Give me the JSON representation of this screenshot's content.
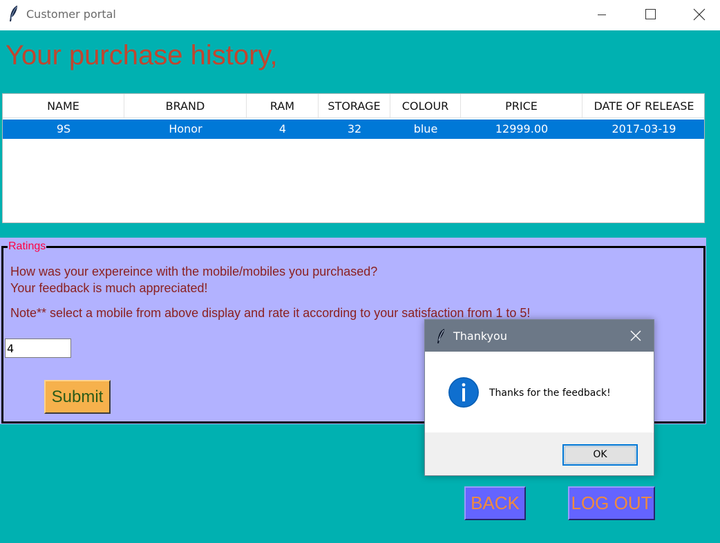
{
  "window": {
    "title": "Customer portal",
    "icon": "feather-icon"
  },
  "heading": "Your purchase history,",
  "table": {
    "columns": [
      "NAME",
      "BRAND",
      "RAM",
      "STORAGE",
      "COLOUR",
      "PRICE",
      "DATE OF RELEASE"
    ],
    "rows": [
      [
        "9S",
        "Honor",
        "4",
        "32",
        "blue",
        "12999.00",
        "2017-03-19"
      ]
    ],
    "selected_row": 0
  },
  "ratings": {
    "legend": "Ratings",
    "question_line1": "How was your expereince with the mobile/mobiles you purchased?",
    "question_line2": "Your feedback is much appreciated!",
    "note": "Note** select a mobile from above display and rate it according to your satisfaction from 1 to 5!",
    "rating_value": "4",
    "submit_label": "Submit"
  },
  "buttons": {
    "back_label": "BACK",
    "logout_label": "LOG OUT"
  },
  "dialog": {
    "title": "Thankyou",
    "message": "Thanks for the feedback!",
    "ok_label": "OK",
    "icon": "info-icon"
  },
  "colors": {
    "background": "#00b1b1",
    "heading": "#c2452e",
    "selected_row": "#0078d7",
    "ratings_panel": "#b2b2ff",
    "submit_button": "#f6b14c",
    "nav_button": "#6464ff",
    "nav_text": "#f08a3e"
  }
}
